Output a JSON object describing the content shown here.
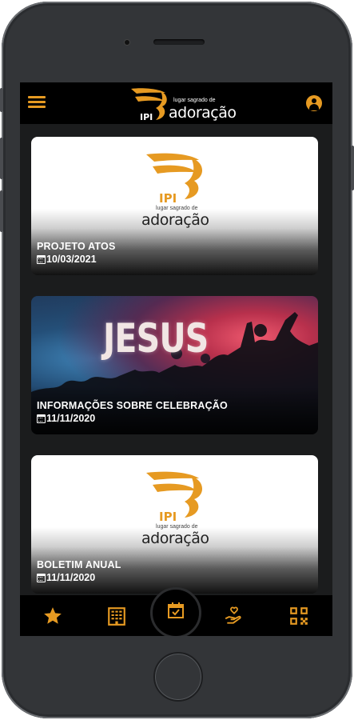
{
  "header": {
    "logo_mark": "IPI",
    "logo_small": "lugar sagrado de",
    "logo_big": "adoração"
  },
  "cards": [
    {
      "title": "PROJETO ATOS",
      "date": "10/03/2021",
      "image": "ipi-logo"
    },
    {
      "title": "INFORMAÇÕES SOBRE CELEBRAÇÃO",
      "date": "11/11/2020",
      "image": "jesus-worship",
      "image_text": "JESUS"
    },
    {
      "title": "BOLETIM ANUAL",
      "date": "11/11/2020",
      "image": "ipi-logo"
    }
  ],
  "bottom_nav": [
    {
      "icon": "star-icon"
    },
    {
      "icon": "building-icon"
    },
    {
      "icon": "calendar-check-icon"
    },
    {
      "icon": "hand-donate-icon"
    },
    {
      "icon": "qr-code-icon"
    }
  ],
  "colors": {
    "accent": "#e69a22",
    "bar": "#000000",
    "background": "#1b1c1d"
  }
}
